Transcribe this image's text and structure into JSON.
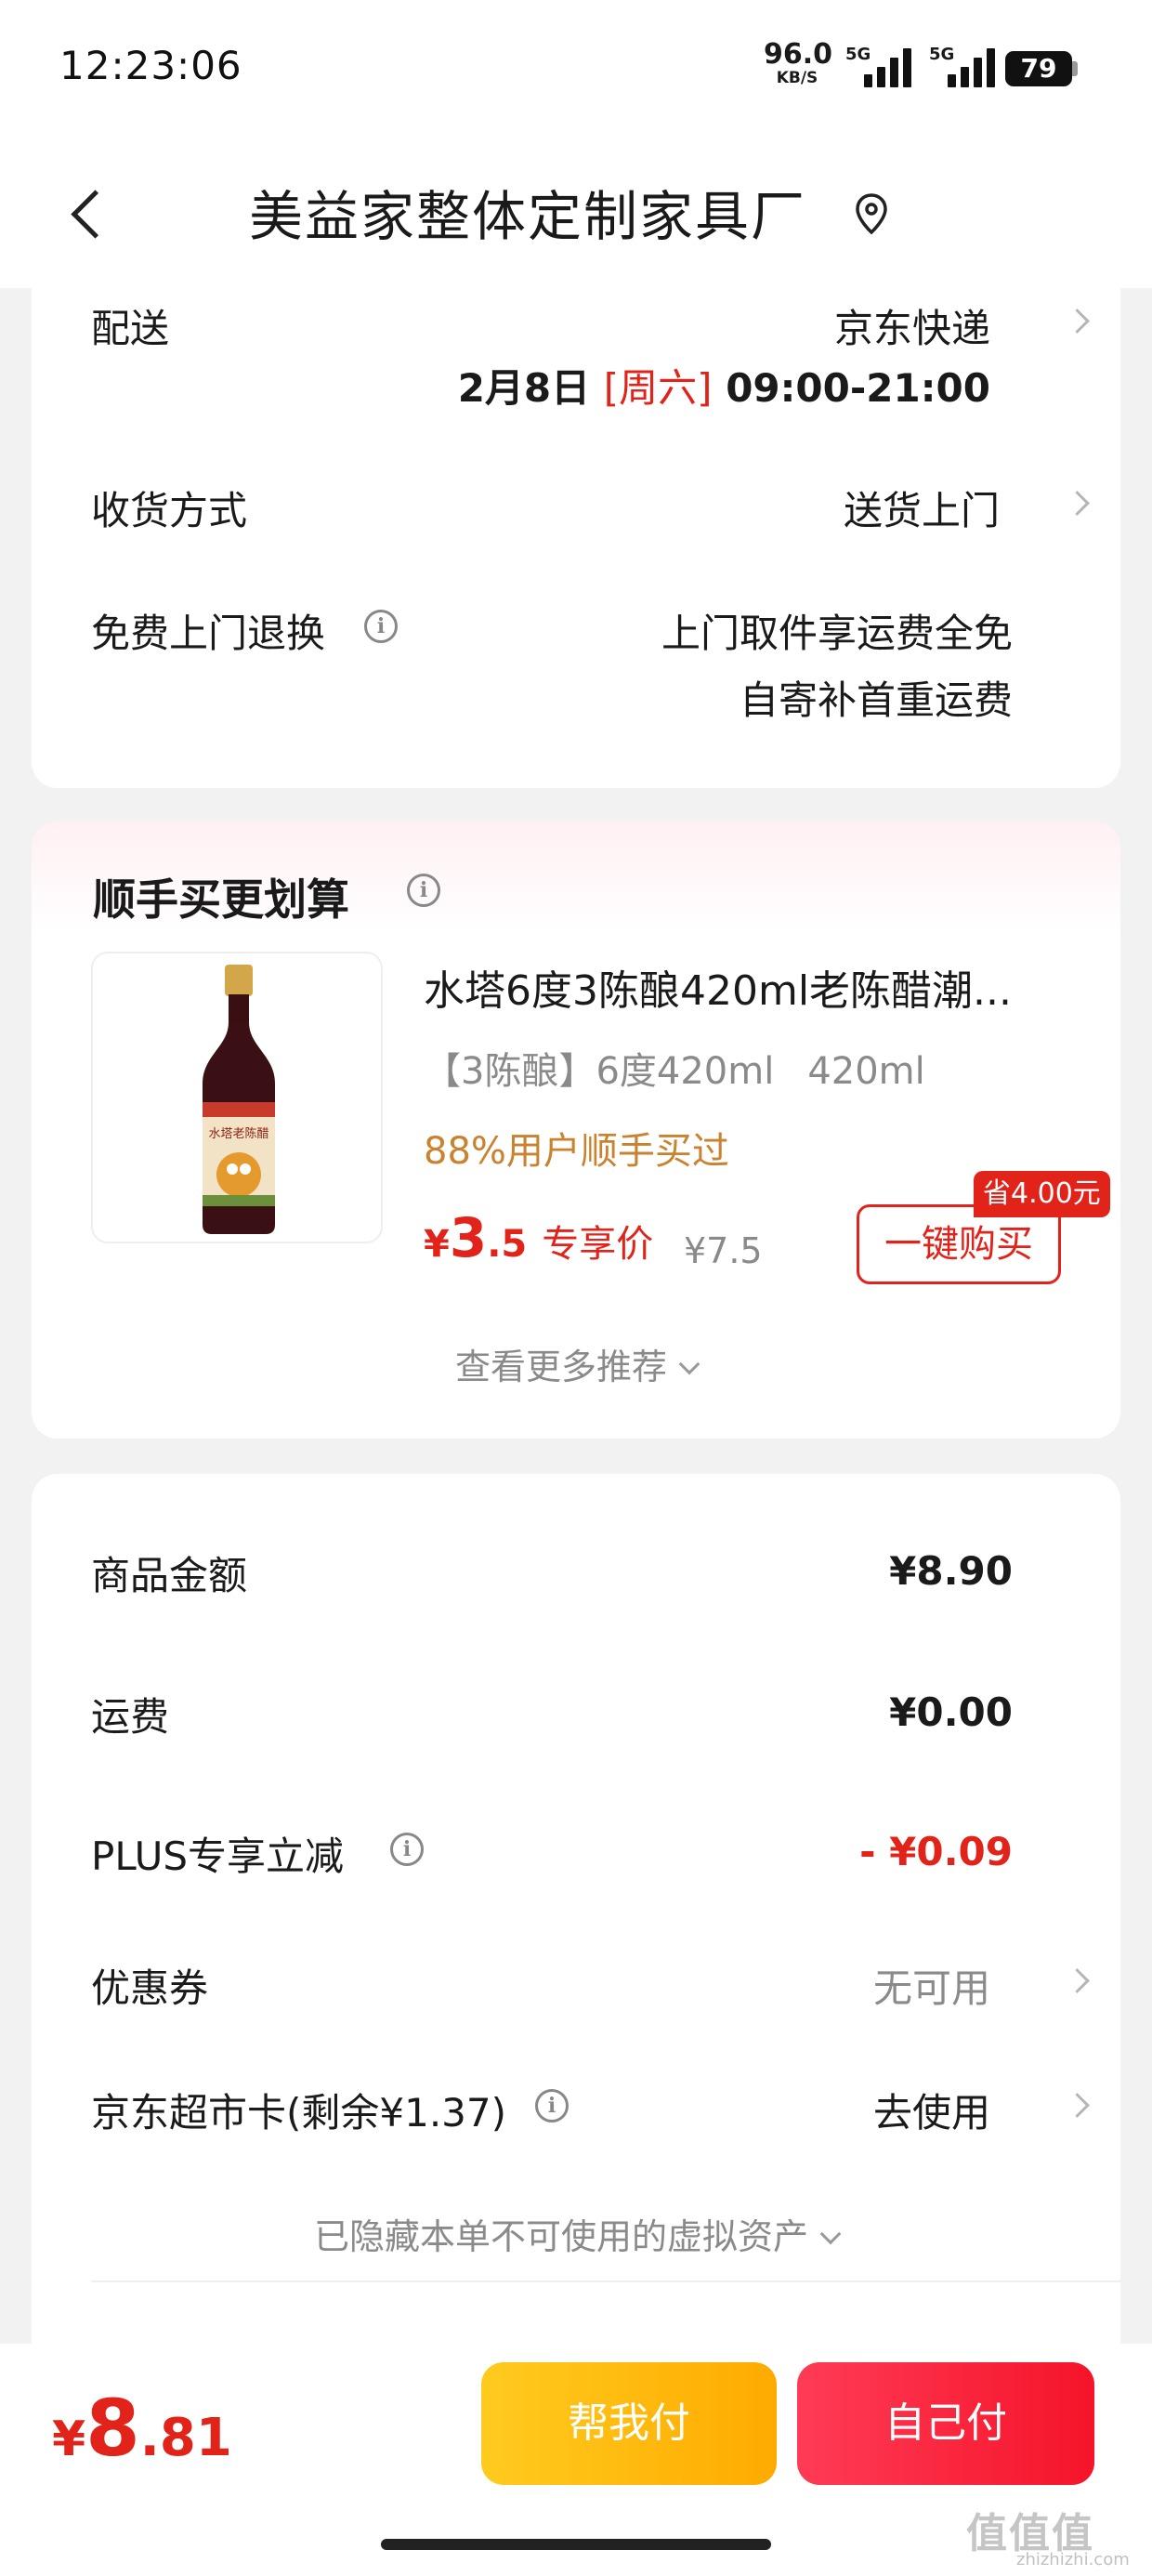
{
  "status_bar": {
    "time": "12:23:06",
    "speed_value": "96.0",
    "speed_unit": "KB/S",
    "sim1": "5G",
    "sim2": "5G",
    "battery": "79"
  },
  "header": {
    "title": "美益家整体定制家具厂",
    "icon": "location-pin-icon"
  },
  "delivery": {
    "label": "配送",
    "carrier": "京东快递",
    "date": "2月8日",
    "weekday": "[周六]",
    "time_window": "09:00-21:00"
  },
  "receive": {
    "label": "收货方式",
    "value": "送货上门"
  },
  "free_return": {
    "label": "免费上门退换",
    "line1": "上门取件享运费全免",
    "line2": "自寄补首重运费"
  },
  "recommend": {
    "title": "顺手买更划算",
    "product": {
      "name": "水塔6度3陈酿420ml老陈醋潮...",
      "spec1": "【3陈酿】6度420ml",
      "spec2": "420ml",
      "buy_rate": "88%用户顺手买过",
      "price_yen": "¥",
      "price_int": "3",
      "price_dec": ".5",
      "price_tag": "专享价",
      "original_price": "¥7.5",
      "save_badge": "省4.00元",
      "buy_button": "一键购买",
      "image_label": "水塔老陈醋"
    },
    "more": "查看更多推荐"
  },
  "summary": {
    "goods_label": "商品金额",
    "goods_value": "¥8.90",
    "freight_label": "运费",
    "freight_value": "¥0.00",
    "plus_label": "PLUS专享立减",
    "plus_value": "- ¥0.09",
    "coupon_label": "优惠券",
    "coupon_value": "无可用",
    "card_label": "京东超市卡(剩余¥1.37)",
    "card_value": "去使用",
    "hidden_note": "已隐藏本单不可使用的虚拟资产"
  },
  "bottom": {
    "total_yen": "¥",
    "total_int": "8",
    "total_dec": ".81",
    "help_pay": "帮我付",
    "self_pay": "自己付"
  },
  "watermark": {
    "text": "值值值",
    "sub": "zhizhizhi.com"
  },
  "colors": {
    "accent_red": "#e2231a",
    "buy_rate": "#c9822e",
    "help_pay": "#ffb800",
    "self_pay": "#f5142a"
  }
}
